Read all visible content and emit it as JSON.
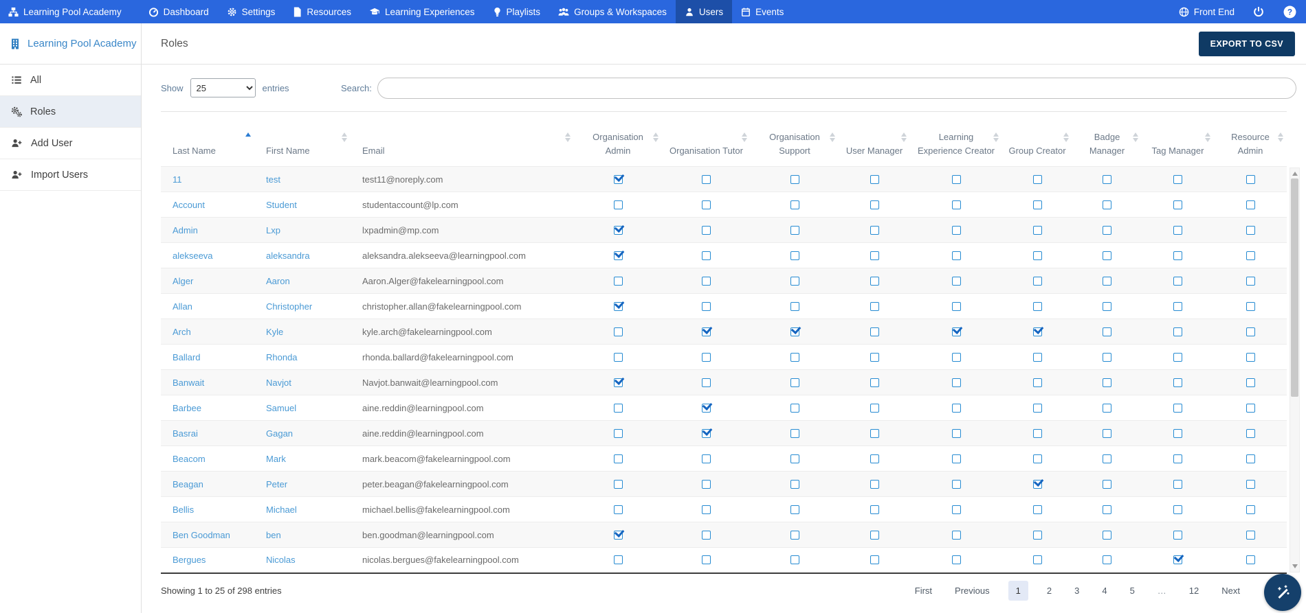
{
  "colors": {
    "navbar_bg": "#2a67de",
    "navbar_active_bg": "#1d4fa8",
    "link_blue": "#4a9ad5",
    "checkbox_blue": "#268bd2",
    "export_button_bg": "#0f3a64",
    "fab_bg": "#15406b"
  },
  "navbar": {
    "brand": "Learning Pool Academy",
    "items": [
      {
        "label": "Dashboard"
      },
      {
        "label": "Settings"
      },
      {
        "label": "Resources"
      },
      {
        "label": "Learning Experiences"
      },
      {
        "label": "Playlists"
      },
      {
        "label": "Groups & Workspaces"
      },
      {
        "label": "Users",
        "active": true
      },
      {
        "label": "Events"
      }
    ],
    "front_end_label": "Front End"
  },
  "sidebar": {
    "title": "Learning Pool Academy",
    "items": [
      {
        "label": "All"
      },
      {
        "label": "Roles",
        "active": true
      },
      {
        "label": "Add User"
      },
      {
        "label": "Import Users"
      }
    ]
  },
  "page": {
    "title": "Roles",
    "export_label": "EXPORT TO CSV"
  },
  "controls": {
    "show_label": "Show",
    "page_size": "25",
    "entries_label": "entries",
    "search_label": "Search:",
    "search_value": ""
  },
  "table": {
    "columns": [
      "Last Name",
      "First Name",
      "Email",
      "Organisation Admin",
      "Organisation Tutor",
      "Organisation Support",
      "User Manager",
      "Learning Experience Creator",
      "Group Creator",
      "Badge Manager",
      "Tag Manager",
      "Resource Admin"
    ],
    "sorted_column": "Last Name",
    "sort_direction": "asc",
    "rows": [
      {
        "last": "11",
        "first": "test",
        "email": "test11@noreply.com",
        "roles": [
          1,
          0,
          0,
          0,
          0,
          0,
          0,
          0,
          0
        ]
      },
      {
        "last": "Account",
        "first": "Student",
        "email": "studentaccount@lp.com",
        "roles": [
          0,
          0,
          0,
          0,
          0,
          0,
          0,
          0,
          0
        ]
      },
      {
        "last": "Admin",
        "first": "Lxp",
        "email": "lxpadmin@mp.com",
        "roles": [
          1,
          0,
          0,
          0,
          0,
          0,
          0,
          0,
          0
        ]
      },
      {
        "last": "alekseeva",
        "first": "aleksandra",
        "email": "aleksandra.alekseeva@learningpool.com",
        "roles": [
          1,
          0,
          0,
          0,
          0,
          0,
          0,
          0,
          0
        ]
      },
      {
        "last": "Alger",
        "first": "Aaron",
        "email": "Aaron.Alger@fakelearningpool.com",
        "roles": [
          0,
          0,
          0,
          0,
          0,
          0,
          0,
          0,
          0
        ]
      },
      {
        "last": "Allan",
        "first": "Christopher",
        "email": "christopher.allan@fakelearningpool.com",
        "roles": [
          1,
          0,
          0,
          0,
          0,
          0,
          0,
          0,
          0
        ]
      },
      {
        "last": "Arch",
        "first": "Kyle",
        "email": "kyle.arch@fakelearningpool.com",
        "roles": [
          0,
          1,
          1,
          0,
          1,
          1,
          0,
          0,
          0
        ]
      },
      {
        "last": "Ballard",
        "first": "Rhonda",
        "email": "rhonda.ballard@fakelearningpool.com",
        "roles": [
          0,
          0,
          0,
          0,
          0,
          0,
          0,
          0,
          0
        ]
      },
      {
        "last": "Banwait",
        "first": "Navjot",
        "email": "Navjot.banwait@learningpool.com",
        "roles": [
          1,
          0,
          0,
          0,
          0,
          0,
          0,
          0,
          0
        ]
      },
      {
        "last": "Barbee",
        "first": "Samuel",
        "email": "aine.reddin@learningpool.com",
        "roles": [
          0,
          1,
          0,
          0,
          0,
          0,
          0,
          0,
          0
        ]
      },
      {
        "last": "Basrai",
        "first": "Gagan",
        "email": "aine.reddin@learningpool.com",
        "roles": [
          0,
          1,
          0,
          0,
          0,
          0,
          0,
          0,
          0
        ]
      },
      {
        "last": "Beacom",
        "first": "Mark",
        "email": "mark.beacom@fakelearningpool.com",
        "roles": [
          0,
          0,
          0,
          0,
          0,
          0,
          0,
          0,
          0
        ]
      },
      {
        "last": "Beagan",
        "first": "Peter",
        "email": "peter.beagan@fakelearningpool.com",
        "roles": [
          0,
          0,
          0,
          0,
          0,
          1,
          0,
          0,
          0
        ]
      },
      {
        "last": "Bellis",
        "first": "Michael",
        "email": "michael.bellis@fakelearningpool.com",
        "roles": [
          0,
          0,
          0,
          0,
          0,
          0,
          0,
          0,
          0
        ]
      },
      {
        "last": "Ben Goodman",
        "first": "ben",
        "email": "ben.goodman@learningpool.com",
        "roles": [
          1,
          0,
          0,
          0,
          0,
          0,
          0,
          0,
          0
        ]
      },
      {
        "last": "Bergues",
        "first": "Nicolas",
        "email": "nicolas.bergues@fakelearningpool.com",
        "roles": [
          0,
          0,
          0,
          0,
          0,
          0,
          0,
          1,
          0
        ]
      }
    ]
  },
  "footer": {
    "status": "Showing 1 to 25 of 298 entries",
    "pagination": [
      "First",
      "Previous",
      "1",
      "2",
      "3",
      "4",
      "5",
      "…",
      "12",
      "Next"
    ],
    "active_page": "1"
  }
}
